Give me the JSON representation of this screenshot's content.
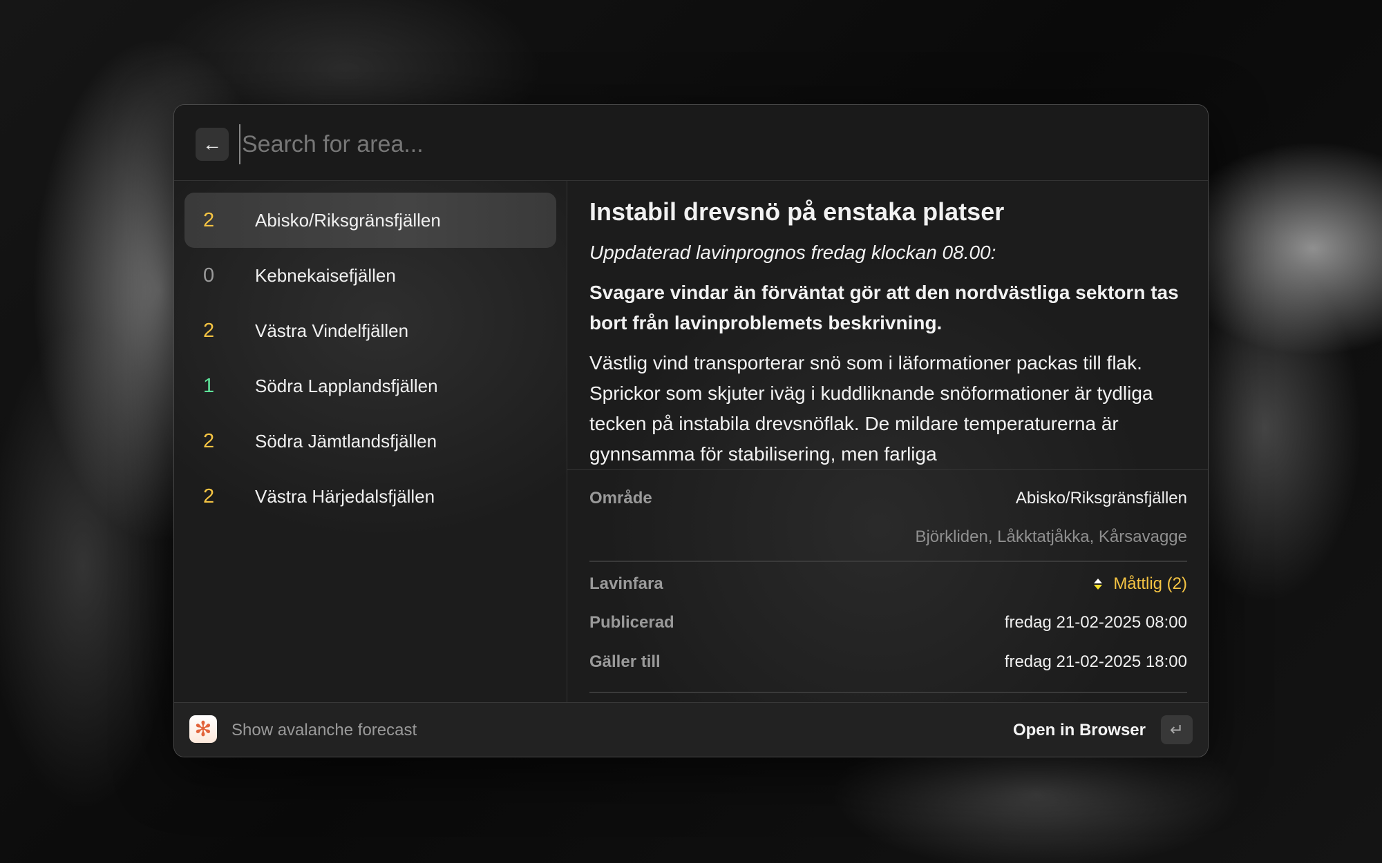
{
  "search": {
    "placeholder": "Search for area...",
    "value": ""
  },
  "icons": {
    "back": "arrow-left-icon",
    "app": "snowflake-icon",
    "enter": "return-key-icon",
    "danger": "danger-level-icon"
  },
  "colors": {
    "level_2": "#f5c443",
    "level_1": "#5ee39a",
    "level_0": "#9a9a9a"
  },
  "areas": [
    {
      "level": "2",
      "name": "Abisko/Riksgränsfjällen",
      "selected": true
    },
    {
      "level": "0",
      "name": "Kebnekaisefjällen"
    },
    {
      "level": "2",
      "name": "Västra Vindelfjällen"
    },
    {
      "level": "1",
      "name": "Södra Lapplandsfjällen"
    },
    {
      "level": "2",
      "name": "Södra Jämtlandsfjällen"
    },
    {
      "level": "2",
      "name": "Västra Härjedalsfjällen"
    }
  ],
  "detail": {
    "title": "Instabil drevsnö på enstaka platser",
    "subtitle": "Uppdaterad lavinprognos fredag klockan 08.00:",
    "bold": "Svagare vindar än förväntat gör att den nordvästliga sektorn tas bort från lavinproblemets beskrivning.",
    "paragraph": "Västlig vind transporterar snö som i läformationer packas till flak. Sprickor som skjuter iväg i kuddliknande snöformationer är tydliga tecken på instabila drevsnöflak. De mildare temperaturerna är gynnsamma för stabilisering, men farliga"
  },
  "metadata": {
    "area_label": "Område",
    "area_value": "Abisko/Riksgränsfjällen",
    "area_sub": "Björkliden, Låkktatjåkka, Kårsavagge",
    "danger_label": "Lavinfara",
    "danger_value": "Måttlig (2)",
    "published_label": "Publicerad",
    "published_value": "fredag 21-02-2025 08:00",
    "valid_label": "Gäller till",
    "valid_value": "fredag 21-02-2025 18:00"
  },
  "footer": {
    "title": "Show avalanche forecast",
    "action": "Open in Browser"
  }
}
